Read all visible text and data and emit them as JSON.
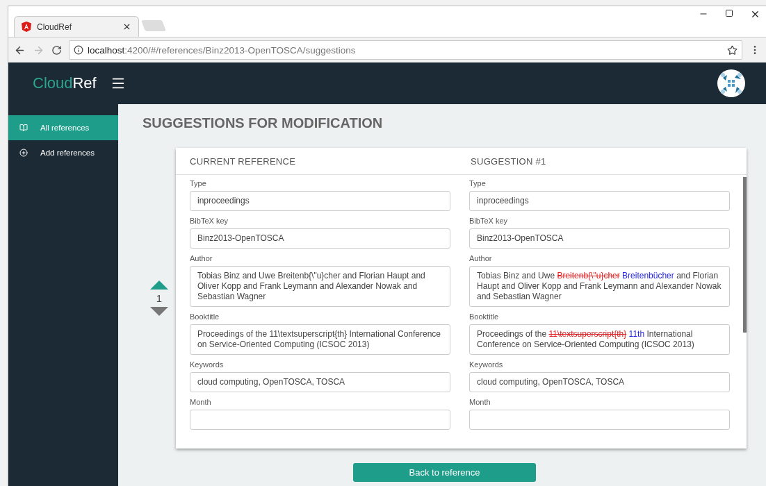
{
  "browser": {
    "tab_title": "CloudRef",
    "url_host": "localhost",
    "url_path": ":4200/#/references/Binz2013-OpenTOSCA/suggestions"
  },
  "app": {
    "logo_first": "Cloud",
    "logo_second": "Ref"
  },
  "sidebar": {
    "items": [
      {
        "label": "All references",
        "selected": true
      },
      {
        "label": "Add references",
        "selected": false
      }
    ]
  },
  "page_title": "SUGGESTIONS FOR MODIFICATION",
  "vote": {
    "count": "1"
  },
  "columns": [
    "CURRENT REFERENCE",
    "SUGGESTION #1"
  ],
  "fields": [
    {
      "current": {
        "label": "Type",
        "value": "inproceedings"
      },
      "suggestion": {
        "label": "Type",
        "segments": [
          {
            "kind": "same",
            "text": "inproceedings"
          }
        ]
      }
    },
    {
      "current": {
        "label": "BibTeX key",
        "value": "Binz2013-OpenTOSCA"
      },
      "suggestion": {
        "label": "BibTeX key",
        "segments": [
          {
            "kind": "same",
            "text": "Binz2013-OpenTOSCA"
          }
        ]
      }
    },
    {
      "current": {
        "label": "Author",
        "value": "Tobias Binz and Uwe Breitenb{\\\"u}cher and Florian Haupt and Oliver Kopp and Frank Leymann and Alexander Nowak and Sebastian Wagner"
      },
      "suggestion": {
        "label": "Author",
        "segments": [
          {
            "kind": "same",
            "text": "Tobias Binz and Uwe "
          },
          {
            "kind": "removed",
            "text": "Breitenb{\\\"u}cher"
          },
          {
            "kind": "added",
            "text": "Breitenbücher"
          },
          {
            "kind": "same",
            "text": " and Florian Haupt and Oliver Kopp and Frank Leymann and Alexander Nowak and Sebastian Wagner"
          }
        ]
      }
    },
    {
      "current": {
        "label": "Booktitle",
        "value": "Proceedings of the 11\\textsuperscript{th} International Conference on Service-Oriented Computing (ICSOC 2013)"
      },
      "suggestion": {
        "label": "Booktitle",
        "segments": [
          {
            "kind": "same",
            "text": "Proceedings of the "
          },
          {
            "kind": "removed",
            "text": "11\\textsuperscript{th}"
          },
          {
            "kind": "added",
            "text": "11th"
          },
          {
            "kind": "same",
            "text": " International Conference on Service-Oriented Computing (ICSOC 2013)"
          }
        ]
      }
    },
    {
      "current": {
        "label": "Keywords",
        "value": "cloud computing, OpenTOSCA, TOSCA"
      },
      "suggestion": {
        "label": "Keywords",
        "segments": [
          {
            "kind": "same",
            "text": "cloud computing, OpenTOSCA, TOSCA"
          }
        ]
      }
    },
    {
      "current": {
        "label": "Month"
      },
      "suggestion": {
        "label": "Month"
      }
    }
  ],
  "back_button": "Back to reference"
}
